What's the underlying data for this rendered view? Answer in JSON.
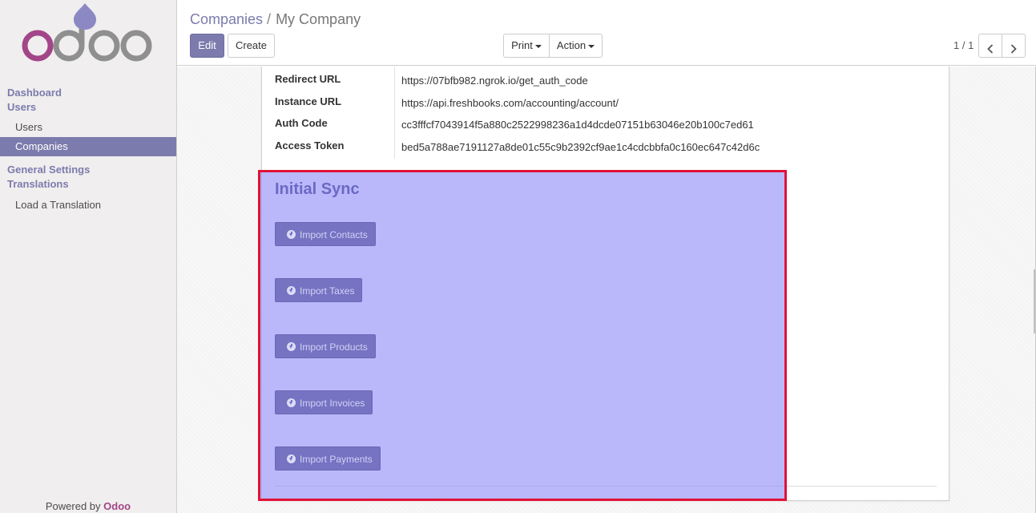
{
  "sidebar": {
    "logo_text": "odoo",
    "menu": {
      "dashboard": "Dashboard",
      "users_section": "Users",
      "users_item": "Users",
      "companies_item": "Companies",
      "general_settings": "General Settings",
      "translations_section": "Translations",
      "load_translation": "Load a Translation"
    },
    "powered_by": "Powered by",
    "powered_brand": "Odoo"
  },
  "control_panel": {
    "breadcrumb_parent": "Companies",
    "breadcrumb_separator": "/",
    "breadcrumb_current": "My Company",
    "edit_label": "Edit",
    "create_label": "Create",
    "print_label": "Print",
    "action_label": "Action",
    "pager_value": "1 / 1"
  },
  "form": {
    "fields": [
      {
        "label": "Redirect URL",
        "value": "https://07bfb982.ngrok.io/get_auth_code"
      },
      {
        "label": "Instance URL",
        "value": "https://api.freshbooks.com/accounting/account/"
      },
      {
        "label": "Auth Code",
        "value": "cc3fffcf7043914f5a880c2522998236a1d4dcde07151b63046e20b100c7ed61"
      },
      {
        "label": "Access Token",
        "value": "bed5a788ae7191127a8de01c55c9b2392cf9ae1c4cdcbbfa0c160ec647c42d6c"
      }
    ],
    "initial_sync": {
      "title": "Initial Sync",
      "buttons": [
        "Import Contacts",
        "Import Taxes",
        "Import Products",
        "Import Invoices",
        "Import Payments"
      ]
    }
  },
  "colors": {
    "brand_primary": "#7c7bad",
    "odoo_magenta": "#a24689",
    "highlight_fill": "#8f8df7",
    "highlight_border": "#e11237"
  }
}
